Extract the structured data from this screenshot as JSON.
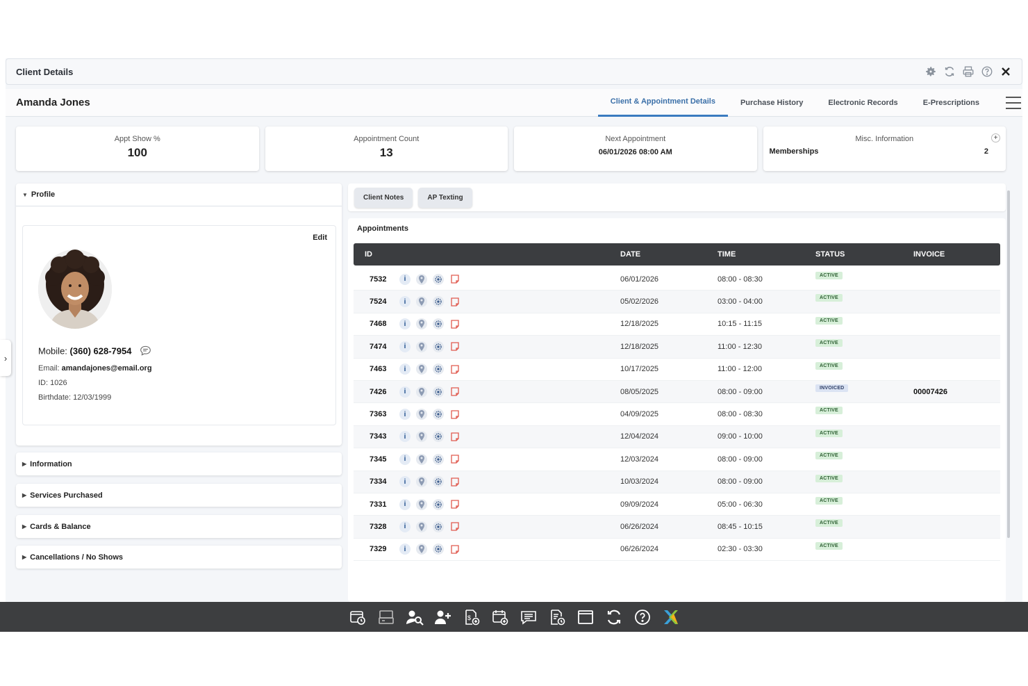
{
  "window": {
    "title": "Client Details"
  },
  "client": {
    "name": "Amanda Jones"
  },
  "tabs": [
    {
      "label": "Client & Appointment Details",
      "active": true
    },
    {
      "label": "Purchase History",
      "active": false
    },
    {
      "label": "Electronic Records",
      "active": false
    },
    {
      "label": "E-Prescriptions",
      "active": false
    }
  ],
  "summary": {
    "show_pct_label": "Appt Show %",
    "show_pct_value": "100",
    "count_label": "Appointment Count",
    "count_value": "13",
    "next_label": "Next Appointment",
    "next_value": "06/01/2026 08:00 AM",
    "misc_label": "Misc. Information",
    "misc_plus": "+",
    "misc_key": "Memberships",
    "misc_value": "2"
  },
  "profile": {
    "section_label": "Profile",
    "edit_label": "Edit",
    "mobile_label": "Mobile:",
    "mobile_value": "(360) 628-7954",
    "email_label": "Email:",
    "email_value": "amandajones@email.org",
    "id_text": "ID: 1026",
    "birthdate_text": "Birthdate: 12/03/1999"
  },
  "sections": [
    {
      "label": "Information"
    },
    {
      "label": "Services Purchased"
    },
    {
      "label": "Cards & Balance"
    },
    {
      "label": "Cancellations / No Shows"
    }
  ],
  "notes_tabs": {
    "client_notes": "Client Notes",
    "ap_texting": "AP Texting"
  },
  "appointments": {
    "title": "Appointments",
    "columns": {
      "id": "ID",
      "date": "DATE",
      "time": "TIME",
      "status": "STATUS",
      "invoice": "INVOICE"
    },
    "rows": [
      {
        "id": "7532",
        "date": "06/01/2026",
        "time": "08:00 - 08:30",
        "status": "ACTIVE",
        "invoice": ""
      },
      {
        "id": "7524",
        "date": "05/02/2026",
        "time": "03:00 - 04:00",
        "status": "ACTIVE",
        "invoice": ""
      },
      {
        "id": "7468",
        "date": "12/18/2025",
        "time": "10:15 - 11:15",
        "status": "ACTIVE",
        "invoice": ""
      },
      {
        "id": "7474",
        "date": "12/18/2025",
        "time": "11:00 - 12:30",
        "status": "ACTIVE",
        "invoice": ""
      },
      {
        "id": "7463",
        "date": "10/17/2025",
        "time": "11:00 - 12:00",
        "status": "ACTIVE",
        "invoice": ""
      },
      {
        "id": "7426",
        "date": "08/05/2025",
        "time": "08:00 - 09:00",
        "status": "INVOICED",
        "invoice": "00007426"
      },
      {
        "id": "7363",
        "date": "04/09/2025",
        "time": "08:00 - 08:30",
        "status": "ACTIVE",
        "invoice": ""
      },
      {
        "id": "7343",
        "date": "12/04/2024",
        "time": "09:00 - 10:00",
        "status": "ACTIVE",
        "invoice": ""
      },
      {
        "id": "7345",
        "date": "12/03/2024",
        "time": "08:00 - 09:00",
        "status": "ACTIVE",
        "invoice": ""
      },
      {
        "id": "7334",
        "date": "10/03/2024",
        "time": "08:00 - 09:00",
        "status": "ACTIVE",
        "invoice": ""
      },
      {
        "id": "7331",
        "date": "09/09/2024",
        "time": "05:00 - 06:30",
        "status": "ACTIVE",
        "invoice": ""
      },
      {
        "id": "7328",
        "date": "06/26/2024",
        "time": "08:45 - 10:15",
        "status": "ACTIVE",
        "invoice": ""
      },
      {
        "id": "7329",
        "date": "06/26/2024",
        "time": "02:30 - 03:30",
        "status": "ACTIVE",
        "invoice": ""
      }
    ]
  },
  "toolbar_icons": [
    "settings-icon",
    "refresh-icon",
    "print-icon",
    "help-icon",
    "close-icon"
  ],
  "taskbar_icons": [
    "calendar-clock-icon",
    "register-icon",
    "client-search-icon",
    "add-client-icon",
    "invoice-add-icon",
    "add-appointment-icon",
    "messages-icon",
    "schedule-doc-icon",
    "window-icon",
    "sync-icon",
    "help-icon",
    "app-logo-icon"
  ],
  "colors": {
    "accent": "#3a7bc0",
    "header_dark": "#3b3d40",
    "active_badge": "#d7efd9",
    "invoiced_badge": "#dbe3f3"
  }
}
